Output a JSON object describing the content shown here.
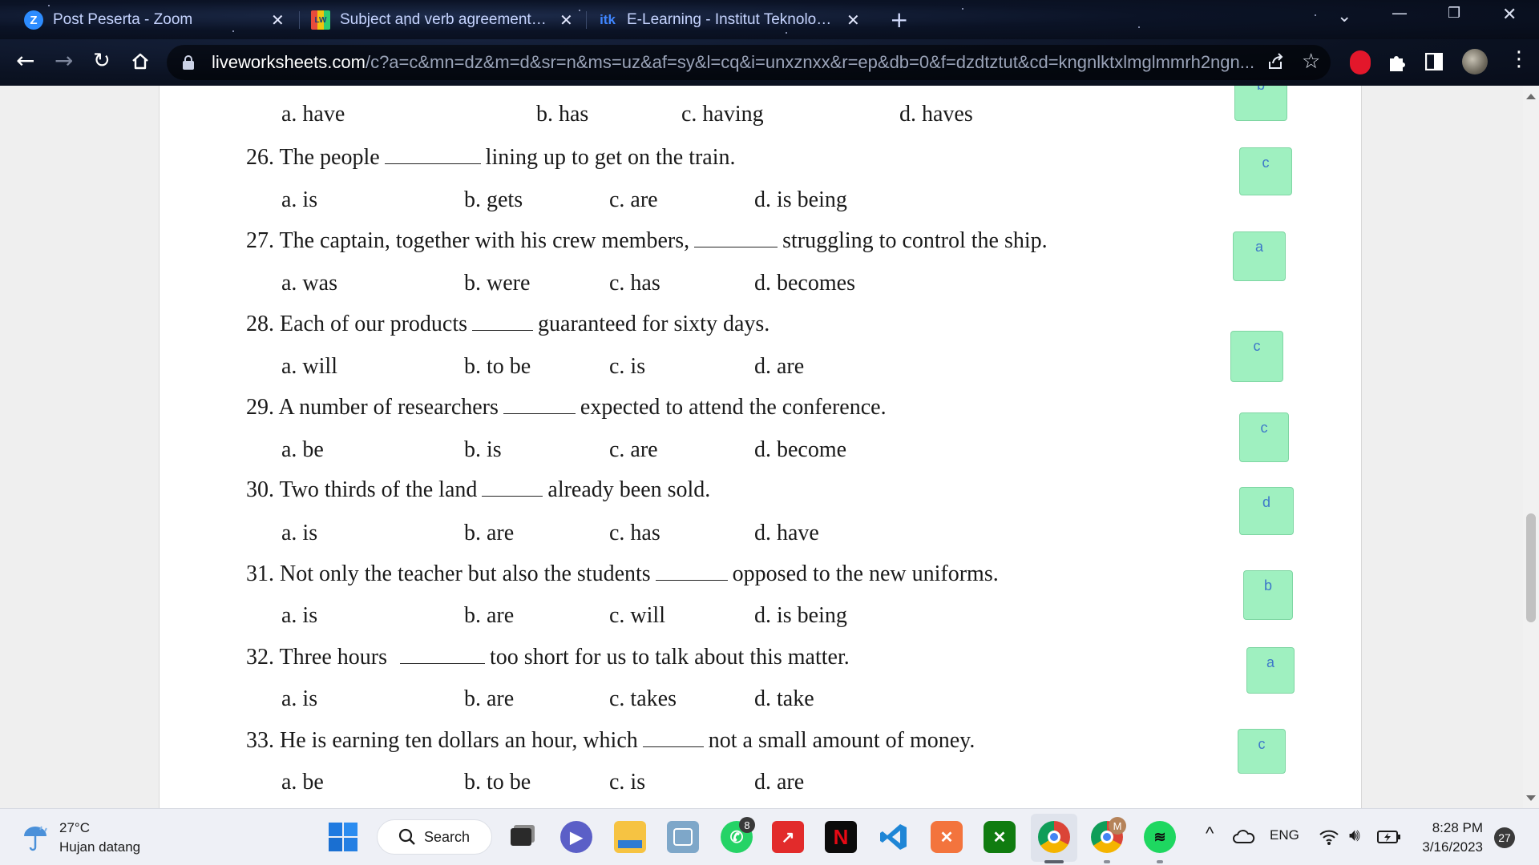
{
  "tabs": [
    {
      "title": "Post Peserta - Zoom",
      "icon": "zoom-icon",
      "close": "✕"
    },
    {
      "title": "Subject and verb agreement onli",
      "icon": "liveworksheets-icon",
      "close": "✕"
    },
    {
      "title": "E-Learning - Institut Teknologi K",
      "icon": "itk-icon",
      "close": "✕"
    }
  ],
  "new_tab": "+",
  "address": {
    "host": "liveworksheets.com",
    "path": "/c?a=c&mn=dz&m=d&sr=n&ms=uz&af=sy&l=cq&i=unxznxx&r=ep&db=0&f=dzdtztut&cd=kngnlktxlmglmmrh2ngn..."
  },
  "worksheet": {
    "partial_options": [
      "a. have",
      "b. has",
      "c. having",
      "d. haves"
    ],
    "partial_answer": "b",
    "questions": [
      {
        "number": "26.",
        "before": "The people",
        "after": "lining up to get on the train.",
        "options": [
          "a. is",
          "b. gets",
          "c. are",
          "d. is being"
        ],
        "answer": "c"
      },
      {
        "number": "27.",
        "before": "The captain, together with his crew members,",
        "after": "struggling to control the ship.",
        "options": [
          "a. was",
          "b. were",
          "c. has",
          "d. becomes"
        ],
        "answer": "a"
      },
      {
        "number": "28.",
        "before": "Each of our products",
        "after": "guaranteed for sixty days.",
        "options": [
          "a. will",
          "b. to be",
          "c. is",
          "d. are"
        ],
        "answer": "c"
      },
      {
        "number": "29.",
        "before": "A number of researchers",
        "after": "expected to attend the conference.",
        "options": [
          "a. be",
          "b. is",
          "c. are",
          "d. become"
        ],
        "answer": "c"
      },
      {
        "number": "30.",
        "before": "Two thirds of the land",
        "after": "already been sold.",
        "options": [
          "a. is",
          "b. are",
          "c. has",
          "d. have"
        ],
        "answer": "d"
      },
      {
        "number": "31.",
        "before": "Not only the teacher but also the students",
        "after": "opposed to the new uniforms.",
        "options": [
          "a. is",
          "b. are",
          "c. will",
          "d. is being"
        ],
        "answer": "b"
      },
      {
        "number": "32.",
        "before": "Three hours",
        "after": "too short for us to talk about this matter.",
        "options": [
          "a. is",
          "b. are",
          "c. takes",
          "d. take"
        ],
        "answer": "a"
      },
      {
        "number": "33.",
        "before": "He is earning ten dollars an hour, which",
        "after": "not a small amount of money.",
        "options": [
          "a. be",
          "b. to be",
          "c. is",
          "d. are"
        ],
        "answer": "c"
      }
    ]
  },
  "taskbar": {
    "weather_temp": "27°C",
    "weather_desc": "Hujan datang",
    "search_label": "Search",
    "whatsapp_badge": "8",
    "chrome_profile_badge": "M",
    "language": "ENG",
    "time": "8:28 PM",
    "date": "3/16/2023",
    "notification_count": "27"
  },
  "colors": {
    "answer_box": "#9ff0c0",
    "answer_text": "#3d78c9",
    "tab_text": "#c6d4ff"
  }
}
